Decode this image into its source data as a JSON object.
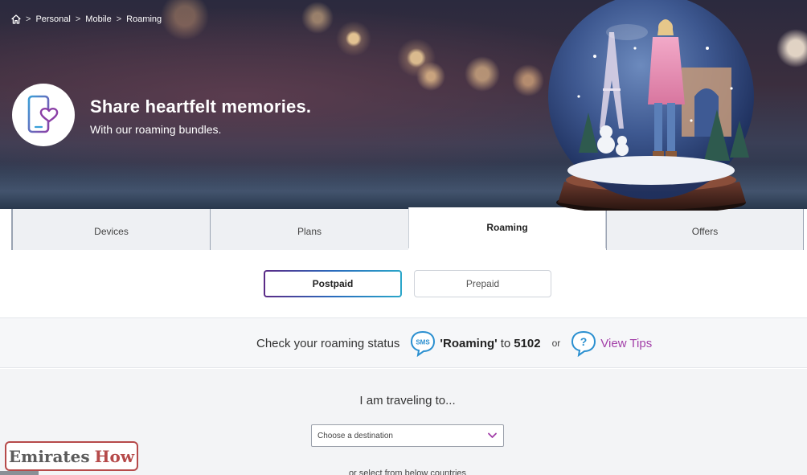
{
  "breadcrumb": {
    "home_icon": "home-icon",
    "items": [
      "Personal",
      "Mobile",
      "Roaming"
    ],
    "separator": ">"
  },
  "hero": {
    "title": "Share heartfelt memories.",
    "subtitle": "With our roaming bundles.",
    "badge_icon": "phone-heart-icon",
    "image": "snow-globe-paris-illustration"
  },
  "tabs": [
    {
      "label": "Devices",
      "active": false
    },
    {
      "label": "Plans",
      "active": false
    },
    {
      "label": "Roaming",
      "active": true
    },
    {
      "label": "Offers",
      "active": false
    }
  ],
  "plan_toggle": {
    "options": [
      {
        "label": "Postpaid",
        "active": true
      },
      {
        "label": "Prepaid",
        "active": false
      }
    ]
  },
  "status": {
    "text": "Check your roaming status",
    "sms_icon": "sms-icon",
    "sms_icon_label": "SMS",
    "keyword": "'Roaming'",
    "to": "to",
    "number": "5102",
    "or": "or",
    "tips_icon": "question-bubble-icon",
    "tips_icon_label": "?",
    "tips_link": "View Tips"
  },
  "destination": {
    "title": "I am traveling to...",
    "placeholder": "Choose a destination",
    "more_text": "or select from below countries"
  },
  "watermark": {
    "part1": "Emirates",
    "part2": "How"
  },
  "colors": {
    "accent_purple": "#a23ea8",
    "gradient_start": "#5b2a86",
    "gradient_end": "#2aa6c9",
    "watermark_red": "#b64a4a"
  }
}
